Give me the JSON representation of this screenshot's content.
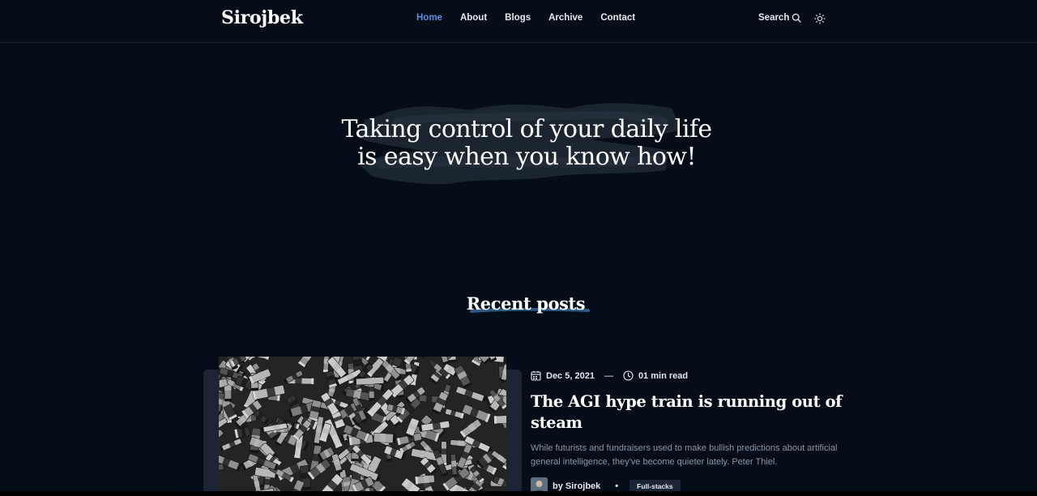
{
  "site": {
    "logo": "Sirojbek"
  },
  "nav": {
    "links": [
      {
        "label": "Home",
        "active": true
      },
      {
        "label": "About",
        "active": false
      },
      {
        "label": "Blogs",
        "active": false
      },
      {
        "label": "Archive",
        "active": false
      },
      {
        "label": "Contact",
        "active": false
      }
    ],
    "search_label": "Search",
    "search_icon": "search-icon",
    "theme_icon": "sun-icon"
  },
  "hero": {
    "title_line1": "Taking control of your daily life",
    "title_line2": "is easy when you know how!"
  },
  "recent": {
    "title": "Recent posts"
  },
  "post": {
    "date": "Dec 5, 2021",
    "separator": "—",
    "read_time": "01 min read",
    "title": "The AGI hype train is running out of steam",
    "excerpt": "While futurists and fundraisers used to make bullish predictions about artificial general intelligence, they've become quieter lately. Peter Thiel.",
    "author": "by Sirojbek",
    "bullet": "•",
    "tag": "Full-stacks"
  },
  "colors": {
    "background": "#040d18",
    "accent": "#5b8fdf",
    "card": "#1b2535",
    "muted_text": "#8a97a8"
  }
}
